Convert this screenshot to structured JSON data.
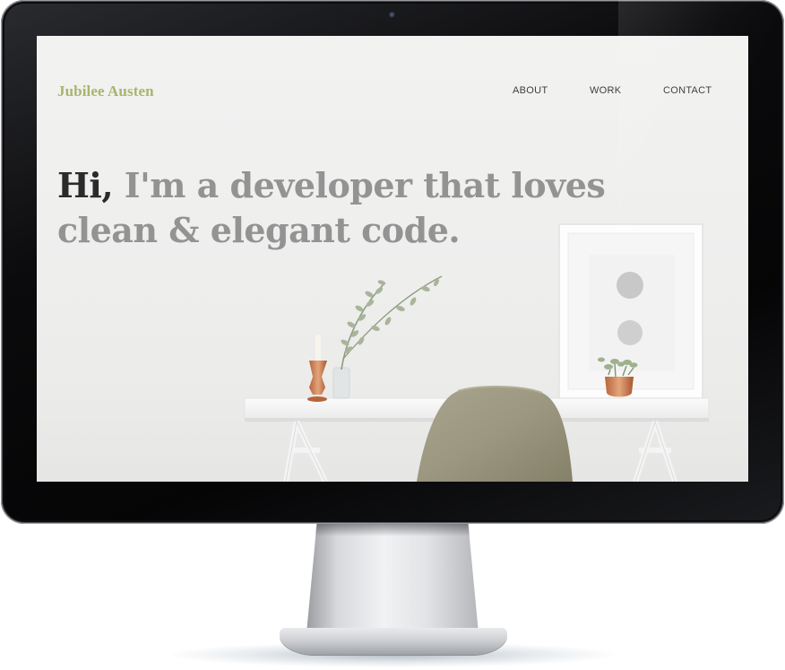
{
  "site": {
    "logo": "Jubilee Austen",
    "nav": {
      "about": "ABOUT",
      "work": "WORK",
      "contact": "CONTACT"
    },
    "hero": {
      "greeting": "Hi,",
      "line1_rest": " I'm a developer that loves",
      "line2": "clean & elegant code."
    }
  },
  "colors": {
    "logo": "#a9b56a",
    "greeting": "#2b2b2b",
    "headline": "#939393",
    "nav": "#3d3d3d",
    "chair": "#9e9a83"
  },
  "icons": {
    "camera": "webcam-dot-icon"
  }
}
